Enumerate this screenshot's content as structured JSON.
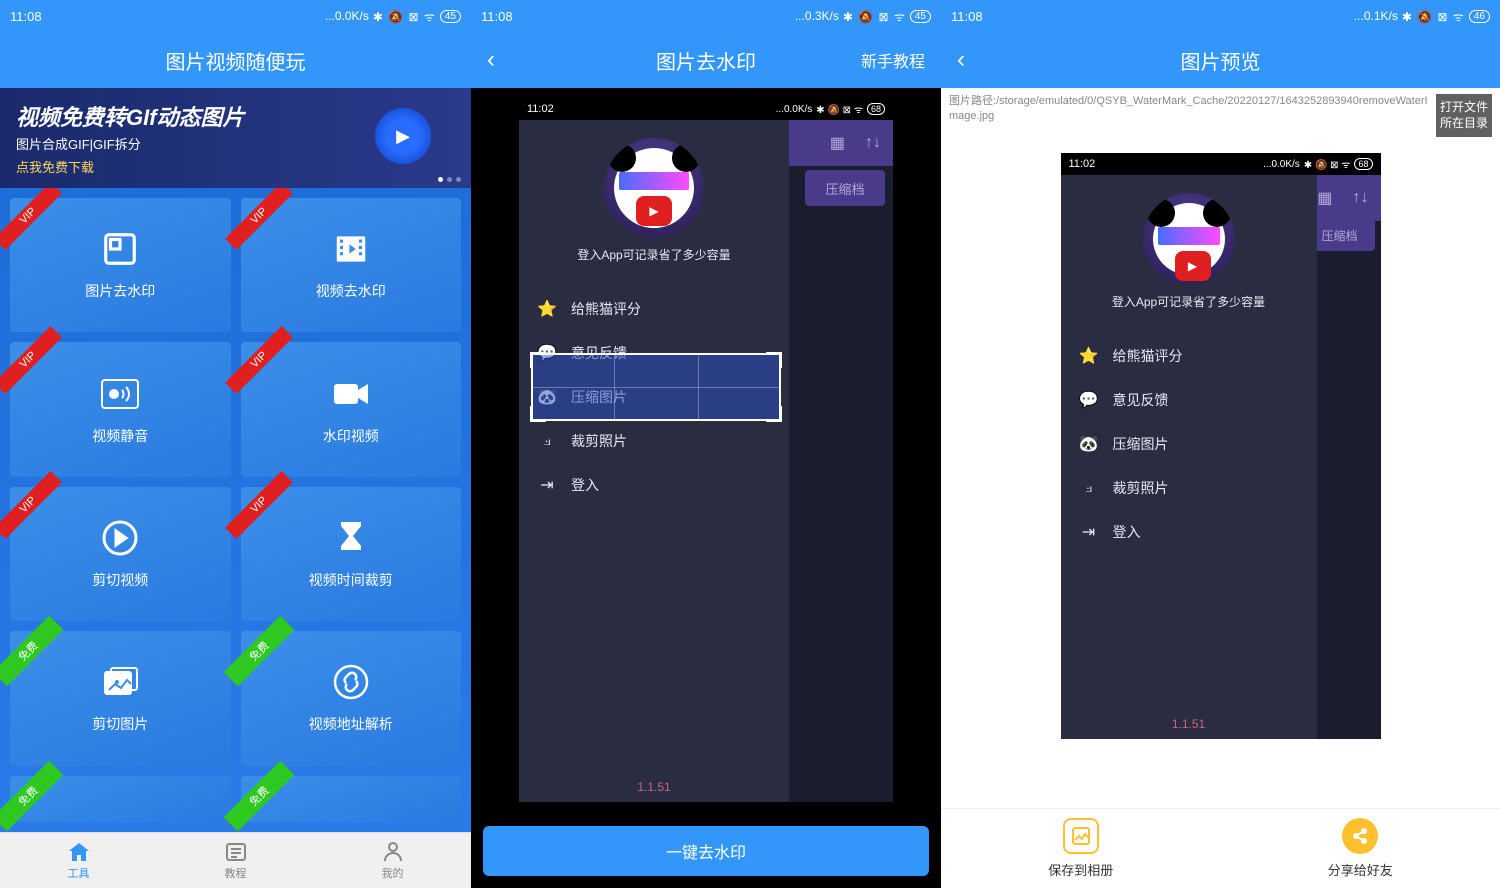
{
  "screen1": {
    "status": {
      "time": "11:08",
      "speed": "...0.0K/s",
      "battery": "45"
    },
    "header": {
      "title": "图片视频随便玩"
    },
    "banner": {
      "title": "视频免费转GIf动态图片",
      "sub": "图片合成GIF|GIF拆分",
      "cta": "点我免费下载"
    },
    "tiles": [
      {
        "label": "图片去水印",
        "badge": "VIP",
        "badgeType": "vip"
      },
      {
        "label": "视频去水印",
        "badge": "VIP",
        "badgeType": "vip"
      },
      {
        "label": "视频静音",
        "badge": "VIP",
        "badgeType": "vip"
      },
      {
        "label": "水印视频",
        "badge": "VIP",
        "badgeType": "vip"
      },
      {
        "label": "剪切视频",
        "badge": "VIP",
        "badgeType": "vip"
      },
      {
        "label": "视频时间裁剪",
        "badge": "VIP",
        "badgeType": "vip"
      },
      {
        "label": "剪切图片",
        "badge": "免费",
        "badgeType": "free"
      },
      {
        "label": "视频地址解析",
        "badge": "免费",
        "badgeType": "free"
      },
      {
        "label": "",
        "badge": "免费",
        "badgeType": "free"
      },
      {
        "label": "",
        "badge": "免费",
        "badgeType": "free"
      }
    ],
    "nav": [
      {
        "label": "工具",
        "active": true
      },
      {
        "label": "教程",
        "active": false
      },
      {
        "label": "我的",
        "active": false
      }
    ]
  },
  "screen2": {
    "status": {
      "time": "11:08",
      "speed": "...0.3K/s",
      "battery": "45"
    },
    "header": {
      "title": "图片去水印",
      "right": "新手教程"
    },
    "inner": {
      "status": {
        "time": "11:02",
        "speed": "...0.0K/s",
        "battery": "68"
      },
      "compress": "压缩档",
      "caption": "登入App可记录省了多少容量",
      "menu": [
        {
          "label": "给熊猫评分"
        },
        {
          "label": "意见反馈"
        },
        {
          "label": "压缩图片"
        },
        {
          "label": "裁剪照片"
        },
        {
          "label": "登入"
        }
      ],
      "version": "1.1.51"
    },
    "action": "一键去水印"
  },
  "screen3": {
    "status": {
      "time": "11:08",
      "speed": "...0.1K/s",
      "battery": "46"
    },
    "header": {
      "title": "图片预览"
    },
    "path_prefix": "图片路径:",
    "path": "/storage/emulated/0/QSYB_WaterMark_Cache/20220127/1643252893940removeWaterImage.jpg",
    "open_dir": "打开文件所在目录",
    "inner": {
      "status": {
        "time": "11:02",
        "speed": "...0.0K/s",
        "battery": "68"
      },
      "compress": "压缩档",
      "caption": "登入App可记录省了多少容量",
      "menu": [
        {
          "label": "给熊猫评分"
        },
        {
          "label": "意见反馈"
        },
        {
          "label": "压缩图片"
        },
        {
          "label": "裁剪照片"
        },
        {
          "label": "登入"
        }
      ],
      "version": "1.1.51"
    },
    "actions": [
      {
        "label": "保存到相册"
      },
      {
        "label": "分享给好友"
      }
    ]
  }
}
